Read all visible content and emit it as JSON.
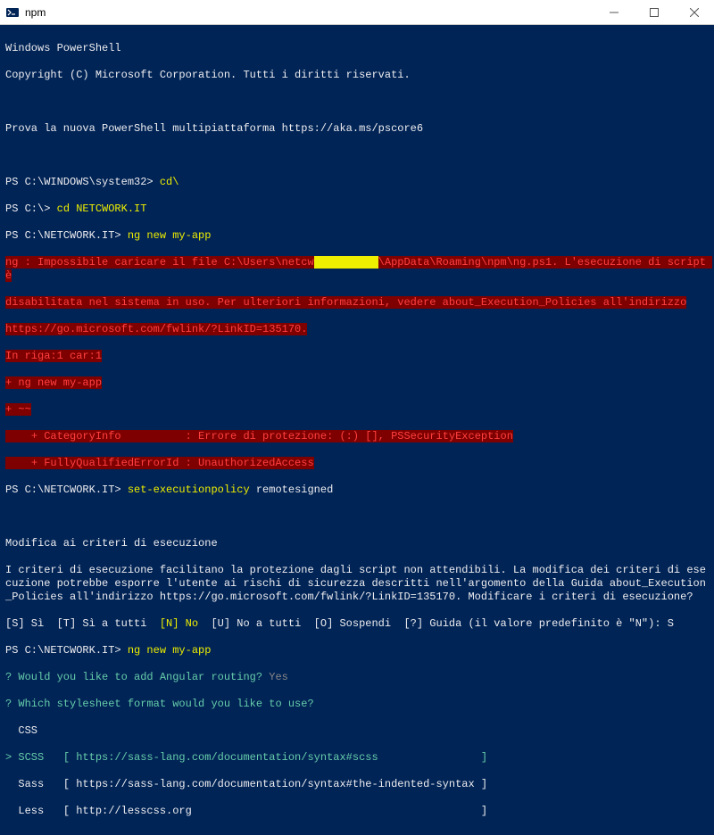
{
  "titlebar": {
    "title": "npm"
  },
  "terminal": {
    "header1": "Windows PowerShell",
    "header2": "Copyright (C) Microsoft Corporation. Tutti i diritti riservati.",
    "tryNew": "Prova la nuova PowerShell multipiattaforma https://aka.ms/pscore6",
    "prompt1": "PS C:\\WINDOWS\\system32>",
    "cmd1": " cd\\",
    "prompt2": "PS C:\\>",
    "cmd2": " cd NETCWORK.IT",
    "prompt3": "PS C:\\NETCWORK.IT>",
    "cmd3": " ng new my-app",
    "errLine1a": "ng : Impossibile caricare il file C:\\Users\\netcw",
    "errRedacted": "XXXXXXXXXX",
    "errLine1b": "\\AppData\\Roaming\\npm\\ng.ps1. L'esecuzione di script è",
    "errLine2": "disabilitata nel sistema in uso. Per ulteriori informazioni, vedere about_Execution_Policies all'indirizzo",
    "errLine3": "https://go.microsoft.com/fwlink/?LinkID=135170.",
    "errLine4": "In riga:1 car:1",
    "errLine5": "+ ng new my-app",
    "errLine6": "+ ~~",
    "errLine7": "    + CategoryInfo          : Errore di protezione: (:) [], PSSecurityException",
    "errLine8": "    + FullyQualifiedErrorId : UnauthorizedAccess",
    "prompt4": "PS C:\\NETCWORK.IT>",
    "cmd4a": " set-executionpolicy",
    "cmd4b": " remotesigned",
    "policyTitle": "Modifica ai criteri di esecuzione",
    "policyBody": "I criteri di esecuzione facilitano la protezione dagli script non attendibili. La modifica dei criteri di esecuzione potrebbe esporre l'utente ai rischi di sicurezza descritti nell'argomento della Guida about_Execution_Policies all'indirizzo https://go.microsoft.com/fwlink/?LinkID=135170. Modificare i criteri di esecuzione?",
    "policyOptions1": "[S] Sì  [T] Sì a tutti  ",
    "policyOptN": "[N] No",
    "policyOptions2": "  [U] No a tutti  [O] Sospendi  [?] Guida (il valore predefinito è \"N\"): S",
    "prompt5": "PS C:\\NETCWORK.IT>",
    "cmd5": " ng new my-app",
    "ngQ1": "? Would you like to add Angular routing? ",
    "ngQ1ans": "Yes",
    "ngQ2": "? Which stylesheet format would you like to use?",
    "optCSS": "  CSS",
    "optSCSSprefix": "> ",
    "optSCSS": "SCSS   [ https://sass-lang.com/documentation/syntax#scss                ]",
    "optSass": "  Sass   [ https://sass-lang.com/documentation/syntax#the-indented-syntax ]",
    "optLess": "  Less   [ http://lesscss.org                                             ]"
  }
}
